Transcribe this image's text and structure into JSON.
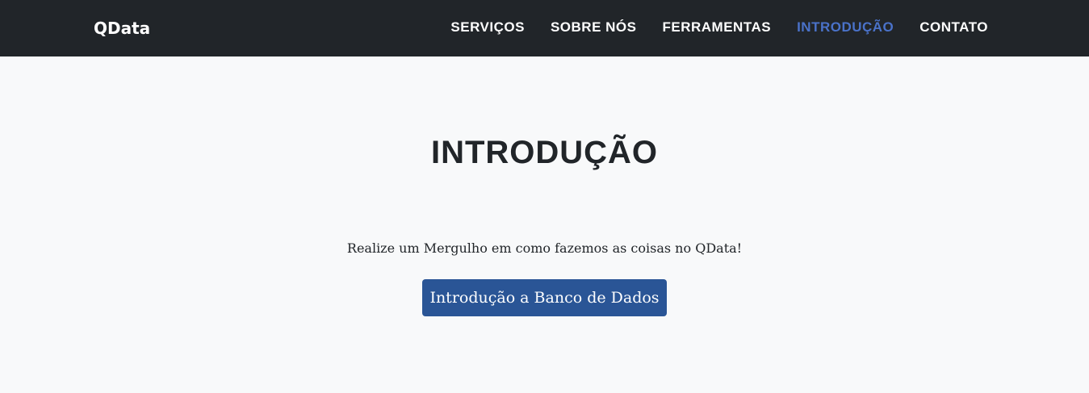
{
  "brand": {
    "name": "QData"
  },
  "nav": {
    "items": [
      {
        "label": "SERVIÇOS"
      },
      {
        "label": "SOBRE NÓS"
      },
      {
        "label": "FERRAMENTAS"
      },
      {
        "label": "INTRODUÇÃO",
        "active": true
      },
      {
        "label": "CONTATO"
      }
    ]
  },
  "section": {
    "title": "INTRODUÇÃO",
    "lead": "Realize um Mergulho em como fazemos as coisas no QData!",
    "button_label": "Introdução a Banco de Dados"
  },
  "colors": {
    "navbar_bg": "#212529",
    "nav_active": "#4a72c9",
    "page_bg": "#f8f9fa",
    "button_bg": "#2a5596"
  }
}
